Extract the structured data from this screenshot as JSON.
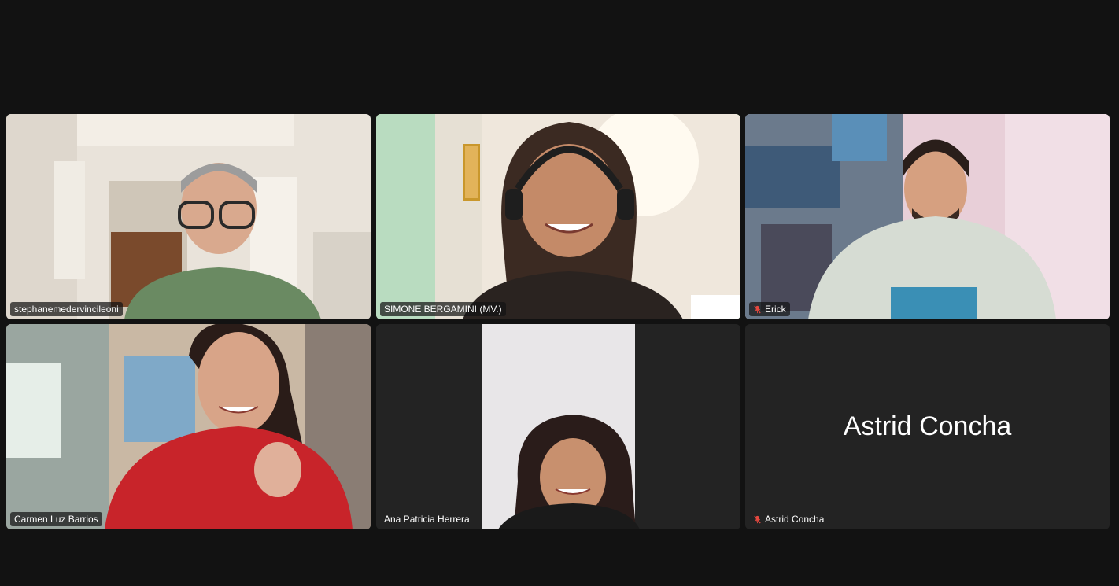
{
  "participants": [
    {
      "name": "stephanemedervincileoni",
      "muted": false,
      "active_speaker": false
    },
    {
      "name": "SIMONE BERGAMINI (MV.)",
      "muted": false,
      "active_speaker": true
    },
    {
      "name": "Erick",
      "muted": true,
      "active_speaker": false
    },
    {
      "name": "Carmen Luz Barrios",
      "muted": false,
      "active_speaker": false
    },
    {
      "name": "Ana Patricia Herrera",
      "muted": false,
      "active_speaker": false
    },
    {
      "name": "Astrid Concha",
      "muted": true,
      "active_speaker": false,
      "video_off": true
    }
  ],
  "colors": {
    "background": "#121212",
    "active_border": "#6fcf5f",
    "mute_red": "#e5483f"
  }
}
